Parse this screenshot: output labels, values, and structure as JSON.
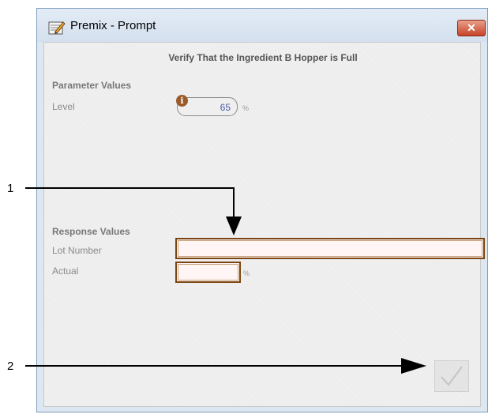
{
  "window": {
    "title": "Premix - Prompt",
    "close_glyph": "✕"
  },
  "prompt": {
    "heading": "Verify That the Ingredient B Hopper is Full"
  },
  "parameters": {
    "heading": "Parameter Values",
    "level_label": "Level",
    "level_value": "65",
    "level_unit": "%",
    "info_glyph": "i"
  },
  "responses": {
    "heading": "Response Values",
    "lot_number_label": "Lot Number",
    "lot_number_value": "",
    "actual_label": "Actual",
    "actual_value": "",
    "actual_unit": "%"
  },
  "confirm": {
    "icon": "checkmark-icon"
  },
  "callouts": [
    {
      "number": "1"
    },
    {
      "number": "2"
    }
  ]
}
